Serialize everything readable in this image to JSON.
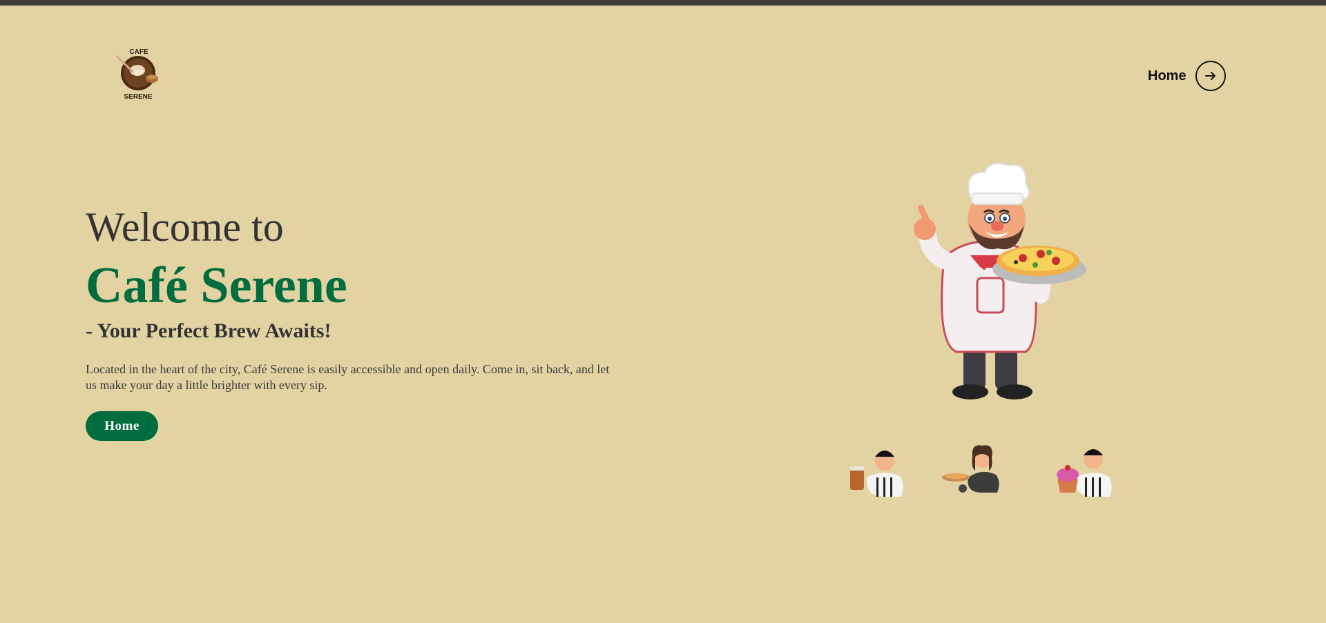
{
  "header": {
    "logo": {
      "top_text": "CAFE",
      "bottom_text": "SERENE",
      "icon": "cafe-logo-icon"
    },
    "nav": {
      "home_label": "Home",
      "arrow_icon": "arrow-right-icon"
    }
  },
  "hero": {
    "welcome": "Welcome to",
    "title": "Café Serene",
    "tagline": "- Your Perfect Brew Awaits!",
    "description": "Located in the heart of the city, Café Serene is easily accessible and open daily. Come in, sit back, and let us make your day a little brighter with every sip.",
    "button_label": "Home"
  },
  "illustrations": {
    "main": "chef-with-pizza-illustration",
    "minis": [
      "server-with-coffee-illustration",
      "server-with-pizza-illustration",
      "server-with-cupcake-illustration"
    ]
  },
  "colors": {
    "background": "#e4d3a2",
    "accent": "#006d3e",
    "text": "#333333",
    "top_strip": "#3f3c37"
  }
}
